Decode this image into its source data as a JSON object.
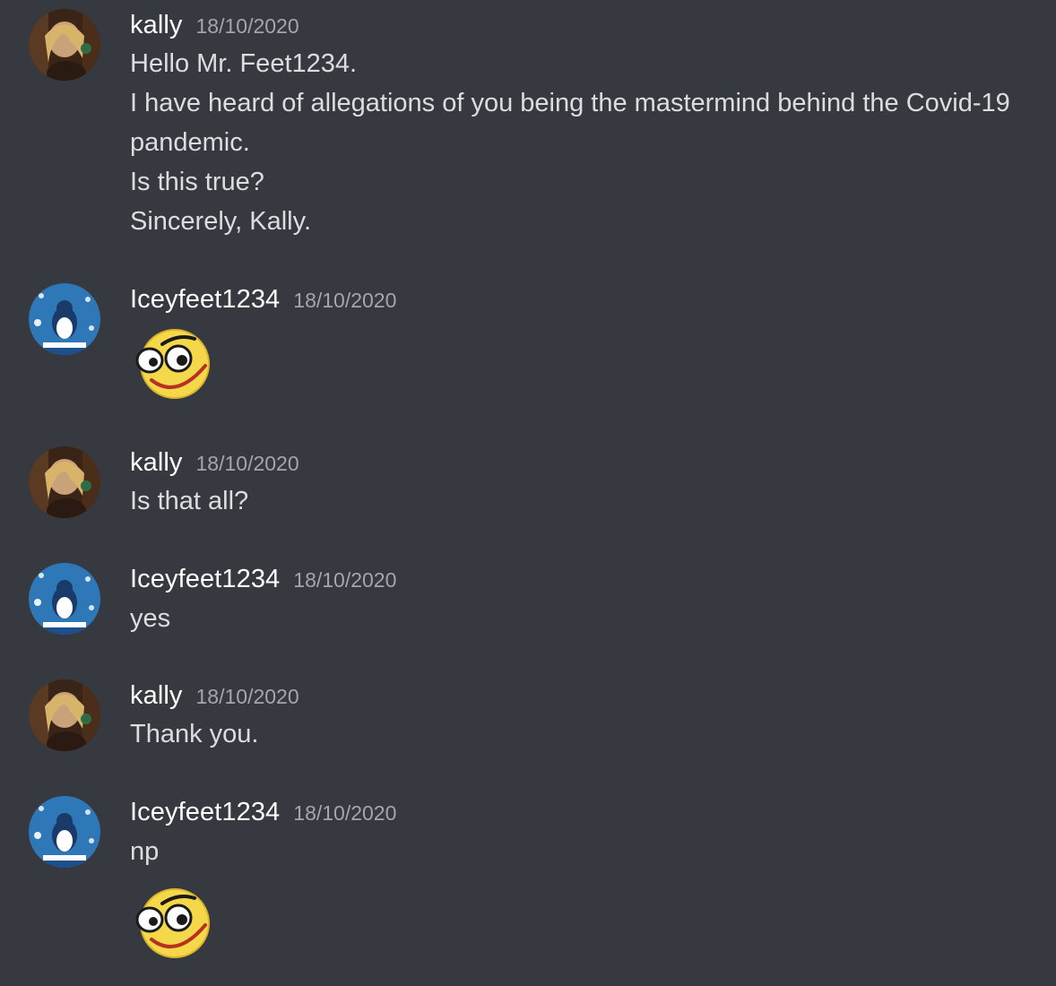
{
  "messages": [
    {
      "author": "kally",
      "avatar_icon": "kally-avatar",
      "timestamp": "18/10/2020",
      "lines": [
        "Hello Mr. Feet1234.",
        "I have heard of allegations of you being the mastermind behind the Covid-19",
        "pandemic.",
        "Is this true?",
        "Sincerely, Kally."
      ]
    },
    {
      "author": "Iceyfeet1234",
      "avatar_icon": "penguin-avatar",
      "timestamp": "18/10/2020",
      "emoji": "smirk-emoji"
    },
    {
      "author": "kally",
      "avatar_icon": "kally-avatar",
      "timestamp": "18/10/2020",
      "lines": [
        "Is that all?"
      ]
    },
    {
      "author": "Iceyfeet1234",
      "avatar_icon": "penguin-avatar",
      "timestamp": "18/10/2020",
      "lines": [
        "yes"
      ]
    },
    {
      "author": "kally",
      "avatar_icon": "kally-avatar",
      "timestamp": "18/10/2020",
      "lines": [
        "Thank you."
      ]
    },
    {
      "author": "Iceyfeet1234",
      "avatar_icon": "penguin-avatar",
      "timestamp": "18/10/2020",
      "lines": [
        "np"
      ],
      "emoji": "smirk-emoji"
    }
  ],
  "colors": {
    "background": "#36393f",
    "username": "#ffffff",
    "text": "#dcddde",
    "timestamp": "#a3a6aa"
  }
}
